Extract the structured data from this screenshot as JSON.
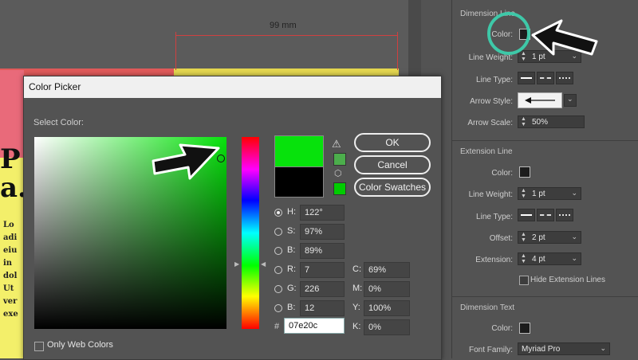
{
  "document": {
    "dimension_label": "99 mm",
    "big_letter_1": "P",
    "big_letter_2": "a.",
    "text_lines": [
      "Lo",
      "adi",
      "eiu",
      "in",
      "dol",
      "Ut",
      "ver",
      "exe"
    ]
  },
  "panel": {
    "dimension_line": {
      "title": "Dimension Line",
      "color_label": "Color:",
      "line_weight_label": "Line Weight:",
      "line_weight_value": "1 pt",
      "line_type_label": "Line Type:",
      "arrow_style_label": "Arrow Style:",
      "arrow_scale_label": "Arrow Scale:",
      "arrow_scale_value": "50%"
    },
    "extension_line": {
      "title": "Extension Line",
      "color_label": "Color:",
      "line_weight_label": "Line Weight:",
      "line_weight_value": "1 pt",
      "line_type_label": "Line Type:",
      "offset_label": "Offset:",
      "offset_value": "2 pt",
      "extension_label": "Extension:",
      "extension_value": "4 pt",
      "hide_label": "Hide Extension Lines"
    },
    "dimension_text": {
      "title": "Dimension Text",
      "color_label": "Color:",
      "font_family_label": "Font Family:",
      "font_family_value": "Myriad Pro"
    }
  },
  "color_picker": {
    "title": "Color Picker",
    "select_label": "Select Color:",
    "ok": "OK",
    "cancel": "Cancel",
    "swatches": "Color Swatches",
    "h_label": "H:",
    "h_value": "122°",
    "s_label": "S:",
    "s_value": "97%",
    "b_label": "B:",
    "b_value": "89%",
    "r_label": "R:",
    "r_value": "7",
    "g_label": "G:",
    "g_value": "226",
    "bl_label": "B:",
    "bl_value": "12",
    "c_label": "C:",
    "c_value": "69%",
    "m_label": "M:",
    "m_value": "0%",
    "y_label": "Y:",
    "y_value": "100%",
    "k_label": "K:",
    "k_value": "0%",
    "hex_label": "#",
    "hex_value": "07e20c",
    "web_colors": "Only Web Colors",
    "current_color": "#07e20c",
    "previous_color": "#000000"
  },
  "colors": {
    "accent_ring": "#3ec8a8"
  }
}
